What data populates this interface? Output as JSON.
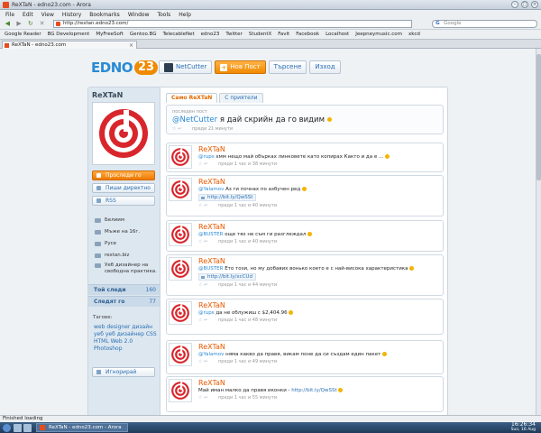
{
  "window": {
    "title": "ReXTaN - edno23.com - Arora",
    "menu": [
      "File",
      "Edit",
      "View",
      "History",
      "Bookmarks",
      "Window",
      "Tools",
      "Help"
    ],
    "url": "http://rextan.edno23.com/",
    "search_placeholder": "Google",
    "bookmarks": [
      "Google Reader",
      "BG Development",
      "MyFreeSoft",
      "Gentoo.BG",
      "TelecableNet",
      "edno23",
      "Twitter",
      "StudentX",
      "Favit",
      "Facebook",
      "Localhost",
      "Jeepneymusic.com",
      "xkcd"
    ],
    "tab_title": "ReXTaN - edno23.com",
    "status": "Finished loading"
  },
  "site": {
    "logo_left": "EDNO",
    "logo_right": "23",
    "nav": [
      {
        "label": "NetCutter"
      },
      {
        "label": "Нов Пост"
      },
      {
        "label": "Търсене"
      },
      {
        "label": "Изход"
      }
    ]
  },
  "sidebar": {
    "name": "ReXTaN",
    "buttons": [
      "Проследи го",
      "Пиши директно",
      "RSS"
    ],
    "info": [
      {
        "text": "Белиим"
      },
      {
        "text": "Мъже на 16г."
      },
      {
        "text": "Русе"
      },
      {
        "text": "rextan.biz"
      },
      {
        "text": "Уеб дизайнер на свободна практика."
      }
    ],
    "following": {
      "label": "Той следи",
      "count": "160"
    },
    "followers": {
      "label": "Следят го",
      "count": "77"
    },
    "tags_label": "Тагове:",
    "tags": "web designer дизайн уеб уеб дизайнер CSS HTML Web 2.0 Photoshop",
    "ignore": "Игнорирай"
  },
  "content": {
    "tabs": [
      "Само ReXTaN",
      "С приятели"
    ],
    "latest": {
      "label": "последен пост",
      "mention": "@NetCutter",
      "text": " я дай скрийн да го видим",
      "meta": "преди 21 минути"
    },
    "posts": [
      {
        "name": "ReXTaN",
        "mention": "@rups",
        "text": " хмм нещо май обърках линковете като копирах  Както и да е ...",
        "link": "",
        "meta": "преди 1 час и 38 минути"
      },
      {
        "name": "ReXTaN",
        "mention": "@Yalamov",
        "text": " Аз ги почнах по азбучен ред",
        "link": "http://bit.ly/QwSSt",
        "meta": "преди 1 час и 40 минути"
      },
      {
        "name": "ReXTaN",
        "mention": "@BUSTER",
        "text": " още тях не съм ги разглеждал",
        "link": "",
        "meta": "преди 1 час и 40 минути"
      },
      {
        "name": "ReXTaN",
        "mention": "@BUSTER",
        "text": " Ето този, но му добавих вонько което е с най-висока характеристика",
        "link": "http://bit.ly/xcCUd",
        "meta": "преди 1 час и 44 минути"
      },
      {
        "name": "ReXTaN",
        "mention": "@rups",
        "text": " да не облужиш с $2,404.96",
        "link": "",
        "meta": "преди 1 час и 48 минути"
      },
      {
        "name": "ReXTaN",
        "mention": "@Yalamov",
        "text": " няма какво да правя, викам поне да си създам един пакет",
        "link": "",
        "meta": "преди 1 час и 49 минути"
      },
      {
        "name": "ReXTaN",
        "mention": "",
        "text": "Май иман малко да правя иконки  - ",
        "url": "http://bit.ly/QwSSt",
        "link": "",
        "meta": "преди 1 час и 55 минути"
      }
    ]
  },
  "taskbar": {
    "task": "ReXTaN - edno23.com - Arora",
    "time": "16:26:34",
    "date": "Sun, 16 Aug"
  }
}
